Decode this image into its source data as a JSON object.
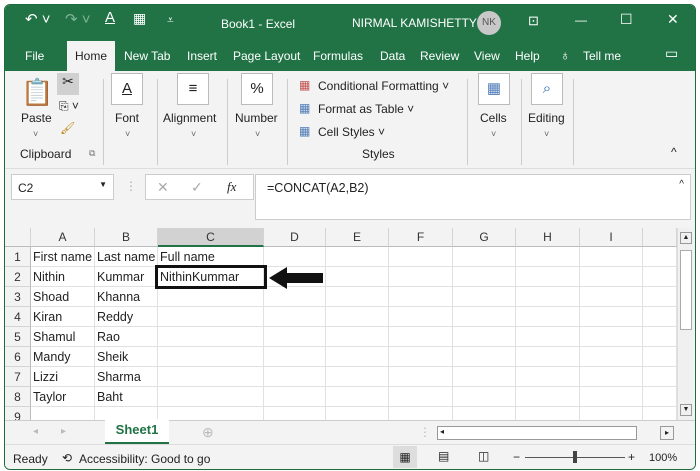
{
  "title": {
    "doc": "Book1  -  Excel",
    "user": "NIRMAL KAMISHETTY",
    "initials": "NK"
  },
  "tabs": [
    "File",
    "Home",
    "New Tab",
    "Insert",
    "Page Layout",
    "Formulas",
    "Data",
    "Review",
    "View",
    "Help",
    "Tell me"
  ],
  "ribbon": {
    "paste": "Paste",
    "clipboard": "Clipboard",
    "font": "Font",
    "alignment": "Alignment",
    "number": "Number",
    "conditional": "Conditional Formatting",
    "format_table": "Format as Table",
    "cell_styles": "Cell Styles",
    "styles": "Styles",
    "cells": "Cells",
    "editing": "Editing"
  },
  "formula_bar": {
    "name_box": "C2",
    "fx": "fx",
    "formula": "=CONCAT(A2,B2)"
  },
  "columns": [
    "A",
    "B",
    "C",
    "D",
    "E",
    "F",
    "G",
    "H",
    "I"
  ],
  "rows": [
    [
      "First name",
      "Last name",
      "Full name"
    ],
    [
      "Nithin",
      "Kummar",
      "NithinKummar"
    ],
    [
      "Shoad",
      "Khanna",
      ""
    ],
    [
      "Kiran",
      "Reddy",
      ""
    ],
    [
      "Shamul",
      "Rao",
      ""
    ],
    [
      "Mandy",
      "Sheik",
      ""
    ],
    [
      "Lizzi",
      "Sharma",
      ""
    ],
    [
      "Taylor",
      "Baht",
      ""
    ],
    [
      "",
      "",
      ""
    ]
  ],
  "selected_cell": "C2",
  "sheet_tab": "Sheet1",
  "status": {
    "ready": "Ready",
    "accessibility": "Accessibility: Good to go",
    "zoom": "100%"
  },
  "colors": {
    "accent": "#217346"
  }
}
